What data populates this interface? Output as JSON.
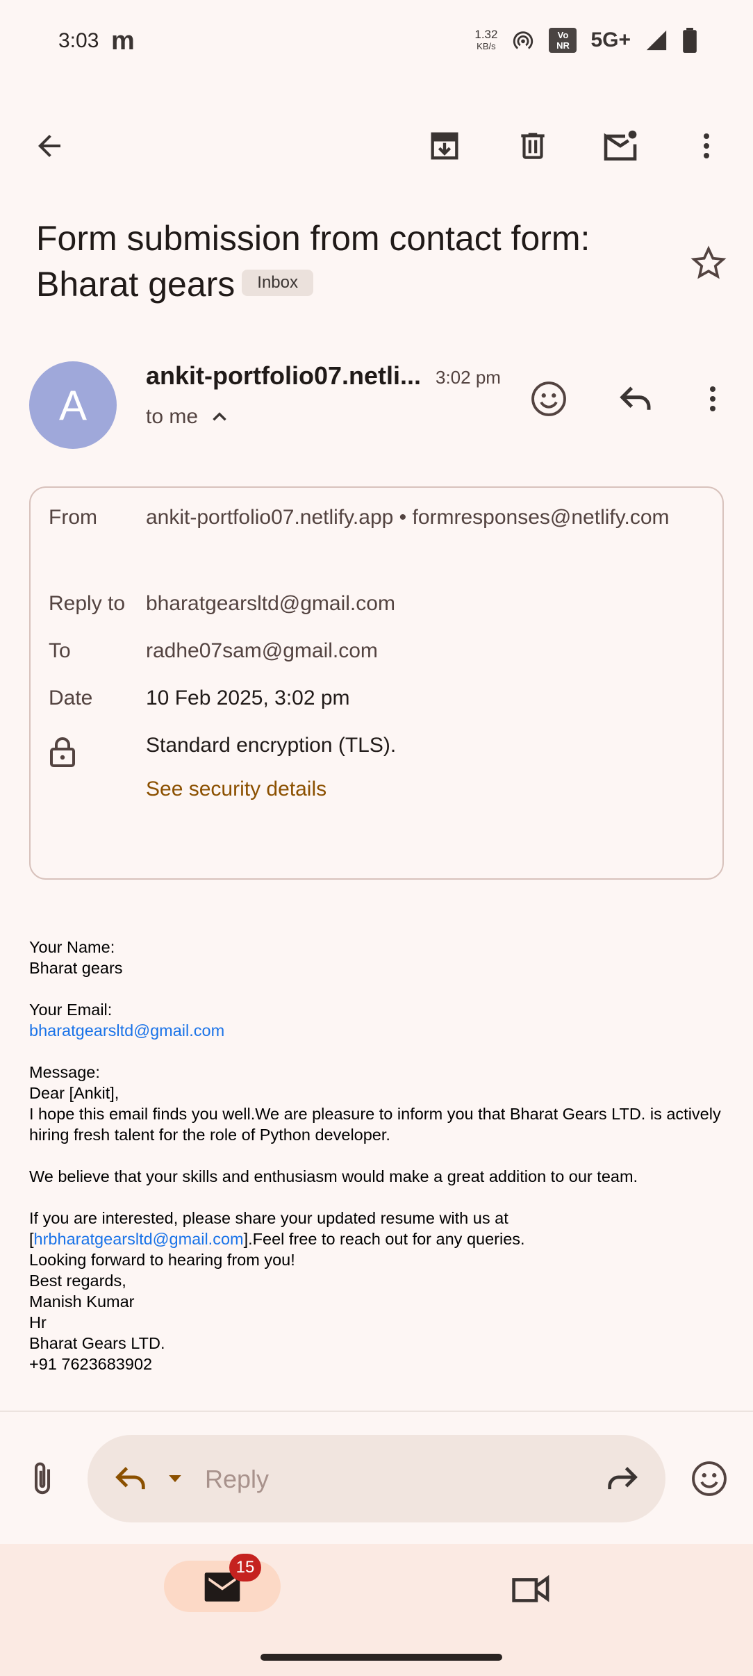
{
  "status_bar": {
    "time": "3:03",
    "carrier_icon": "m",
    "speed_value": "1.32",
    "speed_unit": "KB/s",
    "volte_top": "Vo",
    "volte_bottom": "NR",
    "network": "5G+"
  },
  "toolbar": {
    "back_icon": "arrow-back-icon",
    "archive_icon": "archive-icon",
    "delete_icon": "trash-icon",
    "mark_unread_icon": "mark-unread-icon",
    "more_icon": "more-vert-icon"
  },
  "email": {
    "subject": "Form submission from contact form: Bharat gears",
    "label_badge": "Inbox",
    "sender_initial": "A",
    "sender_name": "ankit-portfolio07.netli...",
    "time": "3:02 pm",
    "recipient_summary": "to me"
  },
  "details": {
    "from_label": "From",
    "from_value": "ankit-portfolio07.netlify.app • formresponses@netlify.com",
    "reply_to_label": "Reply to",
    "reply_to_value": "bharatgearsltd@gmail.com",
    "to_label": "To",
    "to_value": "radhe07sam@gmail.com",
    "date_label": "Date",
    "date_value": "10 Feb 2025, 3:02 pm",
    "encryption_value": "Standard encryption (TLS).",
    "security_link": "See security details"
  },
  "body": {
    "name_label": "Your Name:",
    "name_value": "Bharat gears",
    "email_label": "Your Email:",
    "email_value": "bharatgearsltd@gmail.com",
    "message_label": "Message:",
    "greeting": "Dear [Ankit],",
    "para1": "I hope this email finds you well.We are pleasure to inform you that Bharat Gears LTD. is actively hiring fresh talent for the role of Python developer.",
    "para2": "We believe that your skills and enthusiasm would make a great addition to our team.",
    "para3_line1": "If you are interested, please share your updated resume with us at",
    "para3_bracket_open": "[",
    "para3_link": "hrbharatgearsltd@gmail.com",
    "para3_rest": "].Feel free to reach out for any queries.",
    "closing_line": "Looking forward to hearing from you!",
    "signoff": "Best regards,",
    "sig_name": "Manish Kumar",
    "sig_title": "Hr",
    "sig_company": "Bharat Gears LTD.",
    "sig_phone": "+91 7623683902"
  },
  "reply_bar": {
    "placeholder": "Reply"
  },
  "bottom_nav": {
    "mail_badge_count": "15"
  },
  "colors": {
    "background": "#fdf6f4",
    "avatar": "#9fa8da",
    "link_brown": "#8b5000",
    "link_blue": "#1a73e8",
    "badge_red": "#c5221f"
  }
}
